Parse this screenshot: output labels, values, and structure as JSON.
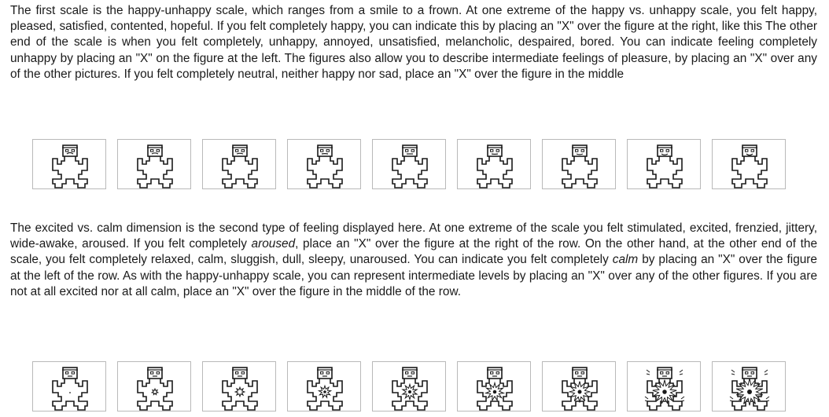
{
  "document": {
    "paragraph1": "The first scale is the happy-unhappy scale, which ranges from a smile to a frown.  At one extreme of the happy vs. unhappy scale, you felt happy, pleased, satisfied, contented, hopeful. If you felt completely happy, you can indicate this by placing an \"X\" over the figure at the right, like this The other end of the scale is when you felt completely, unhappy, annoyed, unsatisfied, melancholic, despaired, bored. You can indicate feeling completely unhappy by placing an \"X\" on the figure at the left. The figures also allow you to describe intermediate feelings of pleasure, by placing an \"X\" over any of the other pictures. If you felt completely neutral, neither happy nor sad, place an \"X\" over the figure in the middle",
    "paragraph2": {
      "part1": "The excited vs. calm dimension is the second type of feeling displayed here. At one extreme of the scale you felt stimulated, excited, frenzied, jittery, wide-awake, aroused. If you felt completely ",
      "em1": "aroused",
      "part2": ", place an \"X\" over the figure at the right of the row. On the other hand, at the other end of the scale, you felt completely relaxed, calm, sluggish, dull, sleepy, unaroused. You can indicate you felt completely ",
      "em2": "calm",
      "part3": " by placing an \"X\" over the figure at the left of the row. As with the happy-unhappy scale, you can represent intermediate levels by placing an \"X\" over any of the other figures. If you are not at all excited nor at all calm, place an \"X\" over the figure in the middle of the row."
    }
  },
  "scales": {
    "pleasure": {
      "figure_count": 9,
      "mouth_curvature": [
        -1,
        -0.75,
        -0.5,
        -0.25,
        0,
        0.25,
        0.5,
        0.75,
        1
      ]
    },
    "arousal": {
      "figure_count": 9,
      "burst_level": [
        0,
        1,
        2,
        3,
        4,
        5,
        6,
        7,
        8
      ]
    }
  },
  "colors": {
    "ink": "#1a1a1a",
    "frame": "#b9b9b9"
  }
}
